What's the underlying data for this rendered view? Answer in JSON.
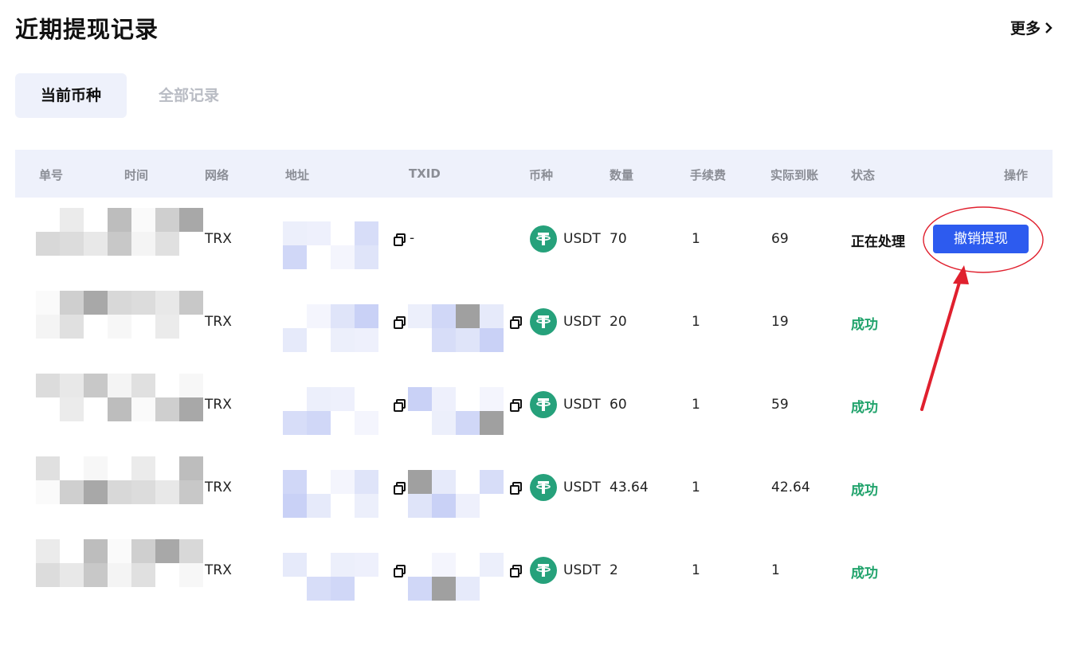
{
  "page": {
    "title": "近期提现记录",
    "more_label": "更多"
  },
  "tabs": [
    {
      "label": "当前币种",
      "active": true
    },
    {
      "label": "全部记录",
      "active": false
    }
  ],
  "table": {
    "columns": [
      "单号",
      "时间",
      "网络",
      "地址",
      "TXID",
      "币种",
      "数量",
      "手续费",
      "实际到账",
      "状态",
      "操作"
    ],
    "rows": [
      {
        "network": "TRX",
        "txid": "-",
        "coin": "USDT",
        "amount": "70",
        "fee": "1",
        "received": "69",
        "status": "正在处理",
        "status_type": "pending",
        "action": "撤销提现"
      },
      {
        "network": "TRX",
        "coin": "USDT",
        "amount": "20",
        "fee": "1",
        "received": "19",
        "status": "成功",
        "status_type": "success"
      },
      {
        "network": "TRX",
        "coin": "USDT",
        "amount": "60",
        "fee": "1",
        "received": "59",
        "status": "成功",
        "status_type": "success"
      },
      {
        "network": "TRX",
        "coin": "USDT",
        "amount": "43.64",
        "fee": "1",
        "received": "42.64",
        "status": "成功",
        "status_type": "success"
      },
      {
        "network": "TRX",
        "coin": "USDT",
        "amount": "2",
        "fee": "1",
        "received": "1",
        "status": "成功",
        "status_type": "success"
      }
    ]
  },
  "colors": {
    "accent": "#2d5bef",
    "success": "#21a36c",
    "usdt": "#26a17b",
    "header_bg": "#eef1fb",
    "annotation": "#e0202e"
  },
  "icons": {
    "more": "chevron-right-icon",
    "copy": "copy-icon",
    "coin": "usdt-tether-icon"
  }
}
